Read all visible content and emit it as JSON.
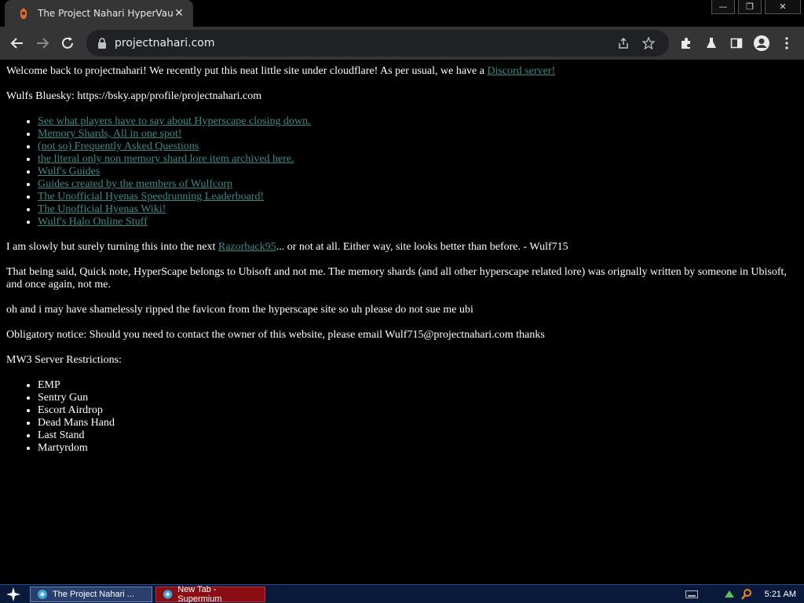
{
  "browser": {
    "tab_title": "The Project Nahari HyperVault!",
    "tab_close": "✕",
    "window_controls": {
      "minimize": "—",
      "restore": "❐",
      "close": "✕"
    },
    "url": "projectnahari.com",
    "icons": {
      "back": "back-arrow-icon",
      "forward": "forward-arrow-icon",
      "reload": "reload-icon",
      "lock": "lock-icon",
      "share": "share-icon",
      "bookmark": "star-icon",
      "extensions": "puzzle-icon",
      "labs": "flask-icon",
      "sidepanel": "side-panel-icon",
      "profile": "profile-icon",
      "menu": "kebab-menu-icon"
    }
  },
  "page": {
    "welcome_text": "Welcome back to projectnahari! We recently put this neat little site under cloudflare! As per usual, we have a ",
    "discord_link": "Discord server!",
    "bluesky": "Wulfs Bluesky: https://bsky.app/profile/projectnahari.com",
    "links": [
      "See what players have to say about Hyperscape closing down.",
      "Memory Shards, All in one spot!",
      "(not so) Frequently Asked Questions",
      "the literal only non memory shard lore item archived here.",
      "Wulf's Guides",
      "Guides created by the members of Wulfcorp",
      "The Unofficial Hyenas Speedrunning Leaderboard!",
      "The Unofficial Hyenas Wiki!",
      "Wulf's Halo Online Stuff"
    ],
    "razorback_before": "I am slowly but surely turning this into the next ",
    "razorback_link": "Razorback95",
    "razorback_after": "... or not at all. Either way, site looks better than before. - Wulf715",
    "note": "That being said, Quick note, HyperScape belongs to Ubisoft and not me. The memory shards (and all other hyperscape related lore) was orignally written by someone in Ubisoft, and once again, not me.",
    "favicon_note": "oh and i may have shamelessly ripped the favicon from the hyperscape site so uh please do not sue me ubi",
    "contact": "Obligatory notice: Should you need to contact the owner of this website, please email Wulf715@projectnahari.com thanks",
    "mw3_heading": "MW3 Server Restrictions:",
    "mw3_items": [
      "EMP",
      "Sentry Gun",
      "Escort Airdrop",
      "Dead Mans Hand",
      "Last Stand",
      "Martyrdom"
    ]
  },
  "taskbar": {
    "start_icon": "start-star-icon",
    "tasks": [
      {
        "label": "The Project Nahari ...",
        "active": true
      },
      {
        "label": "New Tab - Supermium",
        "active": false
      }
    ],
    "clock": "5:21 AM"
  },
  "colors": {
    "link": "#3a8b86",
    "background": "#000000",
    "text": "#ffffff",
    "chrome": "#353535"
  }
}
